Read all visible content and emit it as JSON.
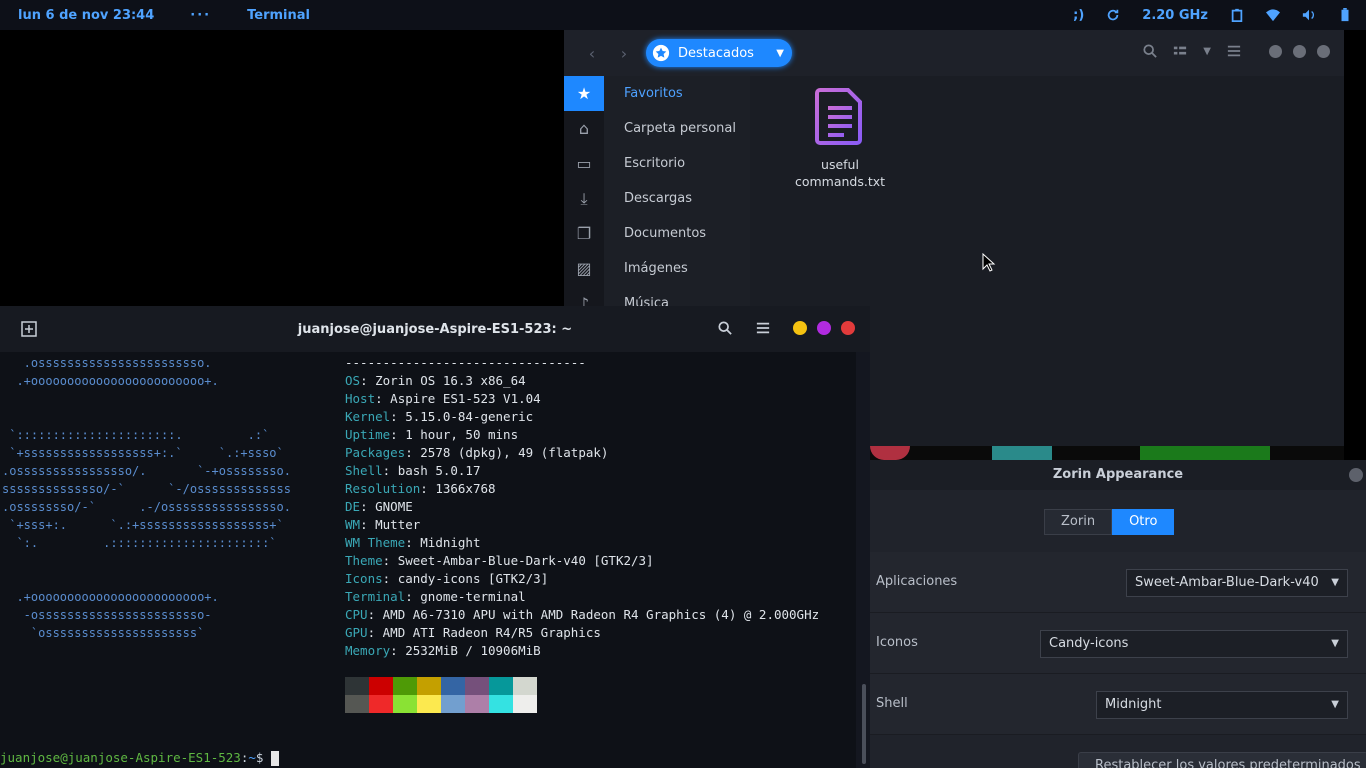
{
  "topbar": {
    "clock": "lun  6 de nov  23:44",
    "dots": "···",
    "app": "Terminal",
    "indicator": ";)",
    "cpu_freq": "2.20 GHz"
  },
  "files": {
    "breadcrumb": "Destacados",
    "places": [
      "Favoritos",
      "Carpeta personal",
      "Escritorio",
      "Descargas",
      "Documentos",
      "Imágenes",
      "Música"
    ],
    "file_name_line1": "useful",
    "file_name_line2": "commands.txt"
  },
  "appearance": {
    "title": "Zorin Appearance",
    "seg_a": "Zorin",
    "seg_b": "Otro",
    "rows": [
      {
        "label": "Aplicaciones",
        "value": "Sweet-Ambar-Blue-Dark-v40"
      },
      {
        "label": "Iconos",
        "value": "Candy-icons"
      },
      {
        "label": "Shell",
        "value": "Midnight"
      }
    ],
    "reset": "Restablecer los valores predeterminados"
  },
  "terminal": {
    "title": "juanjose@juanjose-Aspire-ES1-523: ~",
    "logo": "   .osssssssssssssssssssssso.\n  .+oooooooooooooooooooooooo+.\n\n\n `::::::::::::::::::::::.         .:`\n `+ssssssssssssssssss+:.`     `.:+ssso`\n.ossssssssssssssso/.       `-+ossssssso.\nssssssssssssso/-`      `-/osssssssssssss\n.ossssssso/-`      .-/ossssssssssssssso.\n `+sss+:.      `.:+ssssssssssssssssss+`\n  `:.         .::::::::::::::::::::::`\n\n\n  .+oooooooooooooooooooooooo+.\n   -osssssssssssssssssssssso-\n    `osssssssssssssssssssss`",
    "separator": "--------------------------------",
    "info": [
      {
        "k": "OS",
        "v": "Zorin OS 16.3 x86_64"
      },
      {
        "k": "Host",
        "v": "Aspire ES1-523 V1.04"
      },
      {
        "k": "Kernel",
        "v": "5.15.0-84-generic"
      },
      {
        "k": "Uptime",
        "v": "1 hour, 50 mins"
      },
      {
        "k": "Packages",
        "v": "2578 (dpkg), 49 (flatpak)"
      },
      {
        "k": "Shell",
        "v": "bash 5.0.17"
      },
      {
        "k": "Resolution",
        "v": "1366x768"
      },
      {
        "k": "DE",
        "v": "GNOME"
      },
      {
        "k": "WM",
        "v": "Mutter"
      },
      {
        "k": "WM Theme",
        "v": "Midnight"
      },
      {
        "k": "Theme",
        "v": "Sweet-Ambar-Blue-Dark-v40 [GTK2/3]"
      },
      {
        "k": "Icons",
        "v": "candy-icons [GTK2/3]"
      },
      {
        "k": "Terminal",
        "v": "gnome-terminal"
      },
      {
        "k": "CPU",
        "v": "AMD A6-7310 APU with AMD Radeon R4 Graphics (4) @ 2.000GHz"
      },
      {
        "k": "GPU",
        "v": "AMD ATI Radeon R4/R5 Graphics"
      },
      {
        "k": "Memory",
        "v": "2532MiB / 10906MiB"
      }
    ],
    "palette": [
      "#2e3436",
      "#cc0000",
      "#4e9a06",
      "#c4a000",
      "#3465a4",
      "#75507b",
      "#06989a",
      "#d3d7cf",
      "#555753",
      "#ef2929",
      "#8ae234",
      "#fce94f",
      "#729fcf",
      "#ad7fa8",
      "#34e2e2",
      "#eeeeec"
    ],
    "prompt_user": "juanjose@juanjose-Aspire-ES1-523",
    "prompt_sep": ":",
    "prompt_path": "~",
    "prompt_sym": "$ "
  },
  "colors": {
    "accent": "#1e88ff",
    "panel_bg": "#0d1018"
  }
}
